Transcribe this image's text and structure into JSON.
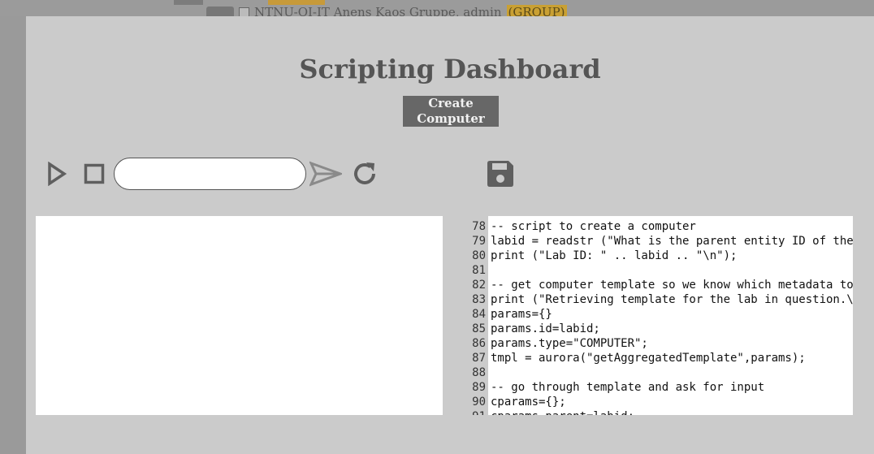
{
  "background": {
    "list_item_label": "NTNU-OI-IT Anens Kaos Gruppe, admin",
    "list_item_badge": "(GROUP)"
  },
  "dialog": {
    "title": "Scripting Dashboard",
    "create_button": "Create Computer",
    "command_input_value": "",
    "command_input_placeholder": ""
  },
  "toolbar_icons": [
    "play-icon",
    "stop-icon",
    "send-icon",
    "reload-icon",
    "save-icon"
  ],
  "editor": {
    "lines": [
      {
        "num": "78",
        "text": "-- script to create a computer"
      },
      {
        "num": "79",
        "text": "labid = readstr (\"What is the parent entity ID of the lab\""
      },
      {
        "num": "80",
        "text": "print (\"Lab ID: \" .. labid .. \"\\n\");"
      },
      {
        "num": "81",
        "text": ""
      },
      {
        "num": "82",
        "text": "-- get computer template so we know which metadata to ask for"
      },
      {
        "num": "83",
        "text": "print (\"Retrieving template for the lab in question.\\n\");"
      },
      {
        "num": "84",
        "text": "params={}"
      },
      {
        "num": "85",
        "text": "params.id=labid;"
      },
      {
        "num": "86",
        "text": "params.type=\"COMPUTER\";"
      },
      {
        "num": "87",
        "text": "tmpl = aurora(\"getAggregatedTemplate\",params);"
      },
      {
        "num": "88",
        "text": ""
      },
      {
        "num": "89",
        "text": "-- go through template and ask for input"
      },
      {
        "num": "90",
        "text": "cparams={};"
      },
      {
        "num": "91",
        "text": "cparams.parent=labid;"
      }
    ]
  },
  "colors": {
    "dialog_bg": "#cbcbcb",
    "button_bg": "#676767",
    "icon_color": "#5f5f5f"
  }
}
